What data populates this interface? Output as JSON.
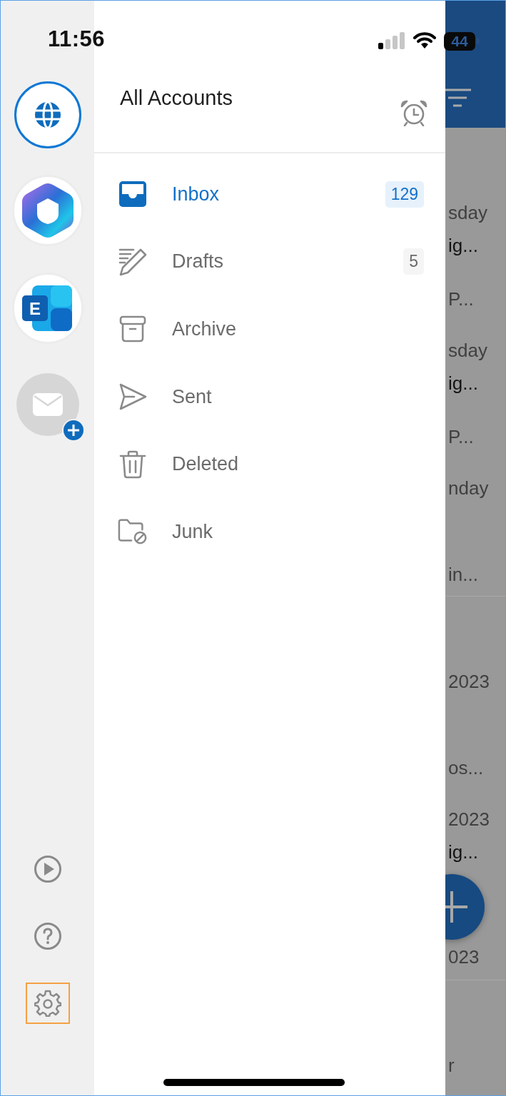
{
  "status_bar": {
    "time": "11:56",
    "battery": "44"
  },
  "account_rail": {
    "accounts": [
      {
        "kind": "all",
        "selected": true
      },
      {
        "kind": "office",
        "selected": false
      },
      {
        "kind": "exchange",
        "logo_letter": "E",
        "selected": false
      },
      {
        "kind": "add",
        "selected": false
      }
    ],
    "footer_buttons": [
      {
        "kind": "play",
        "highlighted": false
      },
      {
        "kind": "help",
        "highlighted": false
      },
      {
        "kind": "settings",
        "highlighted": true
      }
    ]
  },
  "drawer": {
    "title": "All Accounts",
    "folders": [
      {
        "kind": "inbox",
        "label": "Inbox",
        "count": "129",
        "selected": true
      },
      {
        "kind": "drafts",
        "label": "Drafts",
        "count": "5",
        "selected": false
      },
      {
        "kind": "archive",
        "label": "Archive",
        "selected": false
      },
      {
        "kind": "sent",
        "label": "Sent",
        "selected": false
      },
      {
        "kind": "deleted",
        "label": "Deleted",
        "selected": false
      },
      {
        "kind": "junk",
        "label": "Junk",
        "selected": false
      }
    ]
  },
  "background_list": {
    "items": [
      {
        "kind": "message",
        "date": "sday",
        "subject": "ig...",
        "preview": "P..."
      },
      {
        "kind": "message",
        "date": "sday",
        "subject": "ig...",
        "preview": "P..."
      },
      {
        "kind": "message",
        "date": "nday",
        "preview": "in..."
      },
      {
        "kind": "divider"
      },
      {
        "kind": "message",
        "date": "2023",
        "preview": "os..."
      },
      {
        "kind": "message",
        "date": "2023",
        "subject": "ig..."
      },
      {
        "kind": "message",
        "date": "023"
      },
      {
        "kind": "divider"
      },
      {
        "kind": "message",
        "date": "r"
      }
    ]
  }
}
